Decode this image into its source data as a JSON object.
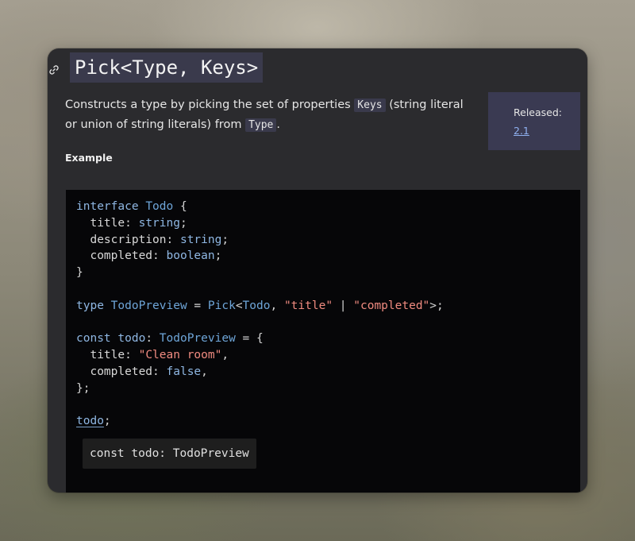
{
  "header": {
    "link_icon": "link-icon",
    "title": "Pick<Type, Keys>"
  },
  "description": {
    "part1": "Constructs a type by picking the set of properties ",
    "code1": "Keys",
    "part2": " (string literal or union of string literals) from ",
    "code2": "Type",
    "part3": "."
  },
  "release": {
    "label": "Released:",
    "version": "2.1"
  },
  "example": {
    "heading": "Example",
    "lines": [
      [
        {
          "t": "interface",
          "c": "kw"
        },
        {
          "t": " "
        },
        {
          "t": "Todo",
          "c": "ty"
        },
        {
          "t": " {"
        }
      ],
      [
        {
          "t": "  "
        },
        {
          "t": "title",
          "c": "prop"
        },
        {
          "t": ": "
        },
        {
          "t": "string",
          "c": "kw"
        },
        {
          "t": ";"
        }
      ],
      [
        {
          "t": "  "
        },
        {
          "t": "description",
          "c": "prop"
        },
        {
          "t": ": "
        },
        {
          "t": "string",
          "c": "kw"
        },
        {
          "t": ";"
        }
      ],
      [
        {
          "t": "  "
        },
        {
          "t": "completed",
          "c": "prop"
        },
        {
          "t": ": "
        },
        {
          "t": "boolean",
          "c": "kw"
        },
        {
          "t": ";"
        }
      ],
      [
        {
          "t": "}"
        }
      ],
      [],
      [
        {
          "t": "type",
          "c": "kw"
        },
        {
          "t": " "
        },
        {
          "t": "TodoPreview",
          "c": "ty"
        },
        {
          "t": " = "
        },
        {
          "t": "Pick",
          "c": "ty"
        },
        {
          "t": "<"
        },
        {
          "t": "Todo",
          "c": "ty"
        },
        {
          "t": ", "
        },
        {
          "t": "\"title\"",
          "c": "str"
        },
        {
          "t": " | "
        },
        {
          "t": "\"completed\"",
          "c": "str"
        },
        {
          "t": ">;"
        }
      ],
      [],
      [
        {
          "t": "const",
          "c": "kw"
        },
        {
          "t": " "
        },
        {
          "t": "todo",
          "c": "var"
        },
        {
          "t": ": "
        },
        {
          "t": "TodoPreview",
          "c": "ty"
        },
        {
          "t": " = {"
        }
      ],
      [
        {
          "t": "  "
        },
        {
          "t": "title",
          "c": "prop"
        },
        {
          "t": ": "
        },
        {
          "t": "\"Clean room\"",
          "c": "str"
        },
        {
          "t": ","
        }
      ],
      [
        {
          "t": "  "
        },
        {
          "t": "completed",
          "c": "prop"
        },
        {
          "t": ": "
        },
        {
          "t": "false",
          "c": "kw"
        },
        {
          "t": ","
        }
      ],
      [
        {
          "t": "};"
        }
      ],
      [],
      [
        {
          "t": "todo",
          "c": "var underlined"
        },
        {
          "t": ";"
        }
      ]
    ],
    "tooltip": "const todo: TodoPreview"
  },
  "colors": {
    "card_bg": "#2b2b2e",
    "code_bg": "#060608",
    "keyword": "#8fb7e3",
    "string": "#f08b80",
    "link": "#8fb0f0"
  }
}
